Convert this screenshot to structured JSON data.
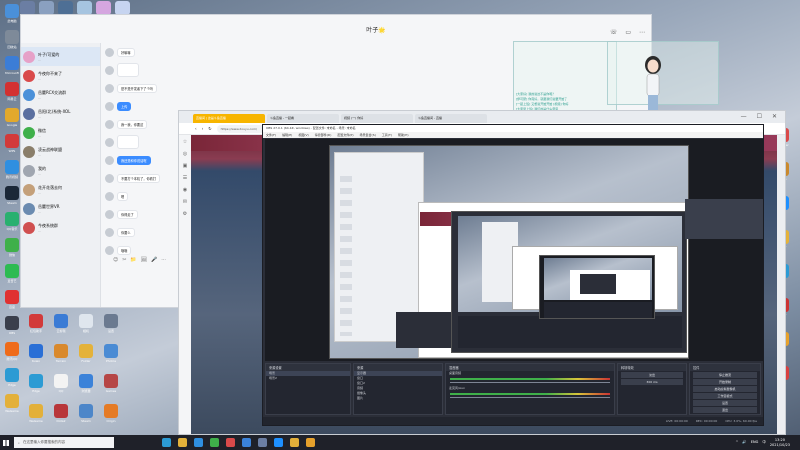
{
  "desktop": {
    "left_icons": [
      {
        "label": "此电脑",
        "color": "#4a90d9"
      },
      {
        "label": "回收站",
        "color": "#7e8a99"
      },
      {
        "label": "Microsoft",
        "color": "#3c7dd6"
      },
      {
        "label": "网易云",
        "color": "#d33131"
      },
      {
        "label": "Google",
        "color": "#e2a92c"
      },
      {
        "label": "WPS",
        "color": "#d23a3a"
      },
      {
        "label": "腾讯视频",
        "color": "#2f8fe0"
      },
      {
        "label": "Steam",
        "color": "#1b2838"
      },
      {
        "label": "QQ音乐",
        "color": "#29b06f"
      },
      {
        "label": "微信",
        "color": "#3fb04a"
      },
      {
        "label": "爱奇艺",
        "color": "#2dbb52"
      },
      {
        "label": "百度",
        "color": "#e03131"
      },
      {
        "label": "OBS",
        "color": "#3a3f4c"
      },
      {
        "label": "腾讯QQ",
        "color": "#ef6b1a"
      },
      {
        "label": "Edge",
        "color": "#2c9bd4"
      },
      {
        "label": "WeGame",
        "color": "#e3b03a"
      }
    ],
    "top_icons": [
      {
        "color": "#6b7ea3"
      },
      {
        "color": "#8aa0c0"
      },
      {
        "color": "#4e6f95"
      },
      {
        "color": "#a6c4e0"
      },
      {
        "color": "#d5a6e0"
      },
      {
        "color": "#c6d4f0"
      }
    ],
    "bottom_icons": [
      {
        "label": "红包助手",
        "color": "#d23a3a"
      },
      {
        "label": "云剪辑",
        "color": "#3a7bd5"
      },
      {
        "label": "相机",
        "color": "#dfe6ee"
      },
      {
        "label": "设置",
        "color": "#6b7a90"
      },
      {
        "label": "Kuwo",
        "color": "#2a6fd6"
      },
      {
        "label": "Terrain",
        "color": "#d9892d"
      },
      {
        "label": "Folder",
        "color": "#e4b23a"
      },
      {
        "label": "Photos",
        "color": "#4a8bd4"
      },
      {
        "label": "Edge",
        "color": "#2c9bd4"
      },
      {
        "label": "QQ",
        "color": "#f3f3f3"
      },
      {
        "label": "浏览器",
        "color": "#3b82d9"
      },
      {
        "label": "Games",
        "color": "#b64646"
      },
      {
        "label": "WeGame",
        "color": "#e3b03a"
      },
      {
        "label": "Dota2",
        "color": "#b8363a"
      },
      {
        "label": "Steam",
        "color": "#4c86c9"
      },
      {
        "label": "Origin",
        "color": "#e57b25"
      }
    ],
    "right_icons": [
      {
        "label": "Recorder",
        "color": "#d94a4a"
      },
      {
        "label": "Game",
        "color": "#c9892e"
      },
      {
        "label": "QQ",
        "color": "#1e90ff"
      },
      {
        "label": "Folder",
        "color": "#e4b23a"
      },
      {
        "label": "Edge",
        "color": "#2c9bd4"
      },
      {
        "label": "Player",
        "color": "#c33"
      },
      {
        "label": "Music",
        "color": "#e6a12c"
      },
      {
        "label": "Video",
        "color": "#d84040"
      }
    ]
  },
  "chat": {
    "title": "叶子🌟",
    "contacts": [
      {
        "name": "叶子/可爱的",
        "preview": "...",
        "time": "",
        "color": "#e6a1c8",
        "active": true
      },
      {
        "name": "今夜你不来了",
        "preview": "...",
        "time": "",
        "color": "#d94a4a"
      },
      {
        "name": "岳麓RCX交流群",
        "preview": "...",
        "time": "",
        "color": "#4a90d9"
      },
      {
        "name": "岳阳(北)系统-XOL",
        "preview": "...",
        "time": "",
        "color": "#5a6fa0"
      },
      {
        "name": "微信",
        "preview": "...",
        "time": "",
        "color": "#3fb04a"
      },
      {
        "name": "凌云战神联盟",
        "preview": "...",
        "time": "",
        "color": "#8a7e6a"
      },
      {
        "name": "我的",
        "preview": "...",
        "time": "",
        "color": "#a0a6b0"
      },
      {
        "name": "花开花落去何",
        "preview": "...",
        "time": "",
        "color": "#c4a07a"
      },
      {
        "name": "岳麓世界VR",
        "preview": "...",
        "time": "",
        "color": "#6b8bb0"
      },
      {
        "name": "今夜系统群",
        "preview": "...",
        "time": "",
        "color": "#d05050"
      }
    ],
    "messages": [
      {
        "text": "好嘛嘛",
        "blue": false
      },
      {
        "text": "",
        "blue": false
      },
      {
        "text": "是不是开发者下了个吗",
        "blue": false
      },
      {
        "text": "上传",
        "blue": true
      },
      {
        "text": "我一我，你要这",
        "blue": false
      },
      {
        "text": "",
        "blue": false
      },
      {
        "text": "我还是和你说话呢",
        "blue": true
      },
      {
        "text": "不要打个本机了，你看打",
        "blue": false
      },
      {
        "text": "嗯",
        "blue": false
      },
      {
        "text": "你得走了",
        "blue": false
      },
      {
        "text": "你要么",
        "blue": false
      },
      {
        "text": "哦哦",
        "blue": false
      }
    ],
    "tool_icons": [
      "😊",
      "✂",
      "📁",
      "🖼",
      "🎤",
      "⋯"
    ]
  },
  "overlay": {
    "lines": [
      "[大家好] 我的说这不是你呢？",
      "[伊可研] 你真好，就跟我们说要开始了",
      "[一起上班] 又想说开始开始 [视频] 你好",
      "[大家早上班] 我们的是什么意思",
      "[时光光影] 继续啊"
    ]
  },
  "browser": {
    "tabs": [
      {
        "label": "直播间 | 这是斗鱼直播",
        "active": true
      },
      {
        "label": "斗鱼直播 - 一起看",
        "active": false
      },
      {
        "label": "视频 (一) 你好",
        "active": false
      },
      {
        "label": "斗鱼直播间 - 直播",
        "active": false
      }
    ],
    "url": "https://www.douyu.com/",
    "side_icons": [
      "☆",
      "◎",
      "▣",
      "☰",
      "◉",
      "✉",
      "⚙"
    ],
    "controls": [
      "—",
      "☐",
      "✕"
    ]
  },
  "obs": {
    "title": "OBS 27.0.1 (64-bit, windows) - 配置文件: 未命名 - 场景: 未命名",
    "menu": [
      "文件(F)",
      "编辑(E)",
      "视图(V)",
      "停靠部件(D)",
      "配置文件(P)",
      "场景集合(S)",
      "工具(T)",
      "帮助(H)"
    ],
    "docks": {
      "scenes": {
        "title": "来源设置",
        "items": [
          "场景",
          "场景2"
        ]
      },
      "sources": {
        "title": "来源",
        "items": [
          "显示器",
          "窗口",
          "窗口2",
          "音频",
          "摄像头",
          "图片"
        ]
      },
      "mixer": {
        "title": "混音器",
        "channels": [
          "桌面音频",
          "麦克风/Aux"
        ]
      },
      "transitions": {
        "title": "转场特效",
        "type": "淡出",
        "duration": "300 ms"
      },
      "controls": {
        "title": "控件",
        "buttons": [
          "停止推流",
          "开始录制",
          "启动虚拟摄像机",
          "工作室模式",
          "设置",
          "退出"
        ]
      }
    },
    "status": [
      "LIVE: 00:00:00",
      "REC: 00:00:00",
      "CPU: 3.0%, 60.00 fps"
    ]
  },
  "taskbar": {
    "search_placeholder": "在这里输入你要搜索的内容",
    "apps": [
      {
        "color": "#2c9bd4"
      },
      {
        "color": "#e4b23a"
      },
      {
        "color": "#2f8fe0"
      },
      {
        "color": "#3fb04a"
      },
      {
        "color": "#d94a4a"
      },
      {
        "color": "#3b82d9"
      },
      {
        "color": "#6b7ea3"
      },
      {
        "color": "#1e90ff"
      },
      {
        "color": "#e3b03a"
      },
      {
        "color": "#e6a12c"
      }
    ],
    "tray_items": [
      "^",
      "🔊",
      "ENG",
      "中"
    ],
    "time": "13:20",
    "date": "2021/10/23"
  }
}
